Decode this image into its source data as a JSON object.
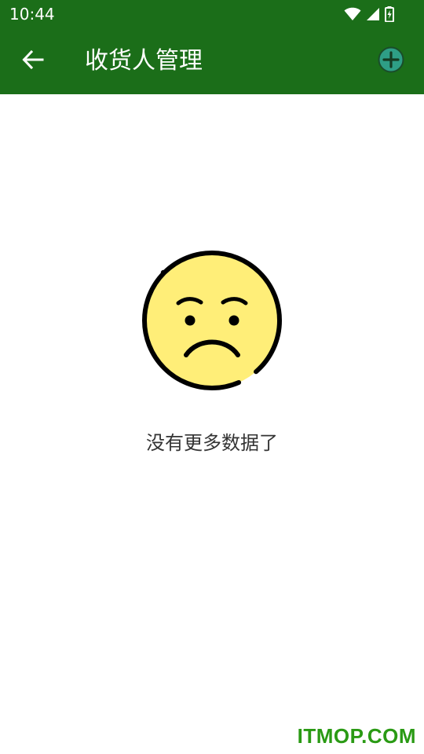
{
  "status_bar": {
    "time": "10:44",
    "icons": [
      "wifi-icon",
      "signal-icon",
      "battery-charging-icon"
    ]
  },
  "app_bar": {
    "title": "收货人管理",
    "back_icon": "arrow-left-icon",
    "add_icon": "plus-circle-icon"
  },
  "empty_state": {
    "icon": "sad-face-icon",
    "message": "没有更多数据了"
  },
  "watermark": {
    "text": "ITMOP.COM"
  },
  "colors": {
    "primary": "#1b6e19",
    "add_icon_fill": "#2e9e86",
    "face_fill": "#ffee78",
    "watermark": "#2a9a14",
    "text": "#333333"
  }
}
